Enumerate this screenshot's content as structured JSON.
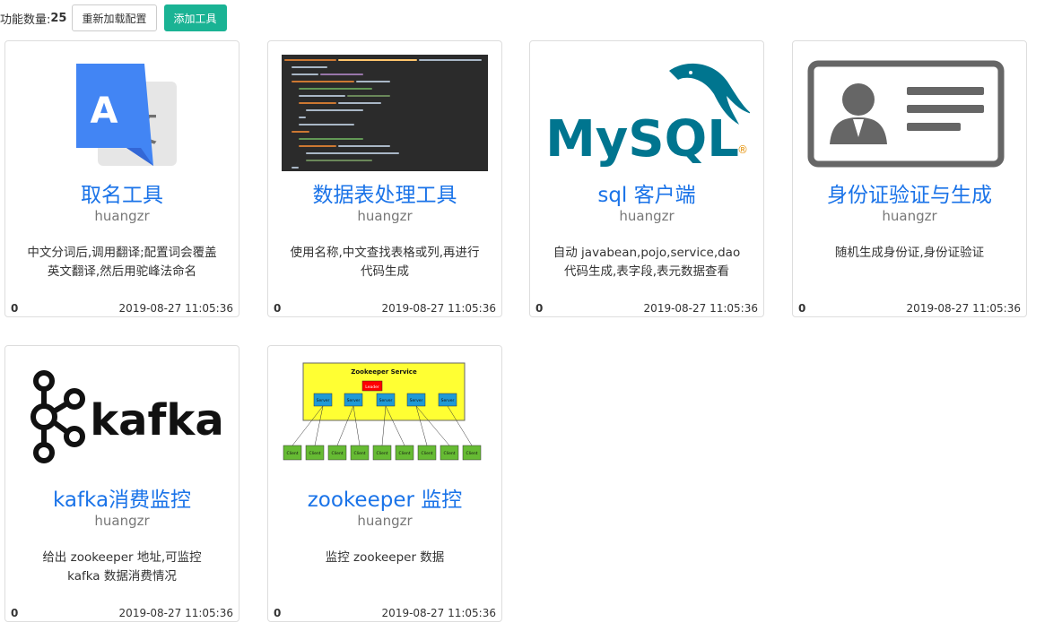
{
  "toolbar": {
    "count_label": "功能数量:",
    "count_value": "25",
    "reload_label": "重新加载配置",
    "add_label": "添加工具",
    "add_color": "#1ab394"
  },
  "cards": [
    {
      "title": "取名工具",
      "author": "huangzr",
      "desc": "中文分词后,调用翻译;配置词会覆盖英文翻译,然后用驼峰法命名",
      "clicks": "0",
      "date": "2019-08-27 11:05:36",
      "icon": "google-translate-icon"
    },
    {
      "title": "数据表处理工具",
      "author": "huangzr",
      "desc": "使用名称,中文查找表格或列,再进行代码生成",
      "clicks": "0",
      "date": "2019-08-27 11:05:36",
      "icon": "code-screenshot-thumbnail"
    },
    {
      "title": "sql 客户端",
      "author": "huangzr",
      "desc": "自动 javabean,pojo,service,dao 代码生成,表字段,表元数据查看",
      "clicks": "0",
      "date": "2019-08-27 11:05:36",
      "icon": "mysql-logo",
      "logo_text": "MySQL"
    },
    {
      "title": "身份证验证与生成",
      "author": "huangzr",
      "desc": "随机生成身份证,身份证验证",
      "clicks": "0",
      "date": "2019-08-27 11:05:36",
      "icon": "id-card-icon"
    },
    {
      "title": "kafka消费监控",
      "author": "huangzr",
      "desc": "给出 zookeeper 地址,可监控 kafka 数据消费情况",
      "clicks": "0",
      "date": "2019-08-27 11:05:36",
      "icon": "kafka-logo",
      "logo_text": "kafka"
    },
    {
      "title": "zookeeper 监控",
      "author": "huangzr",
      "desc": "监控 zookeeper 数据",
      "clicks": "0",
      "date": "2019-08-27 11:05:36",
      "icon": "zookeeper-diagram",
      "diagram": {
        "service_label": "Zookeeper Service",
        "leader_label": "Leader",
        "server_label": "Server",
        "client_label": "Client"
      }
    }
  ]
}
